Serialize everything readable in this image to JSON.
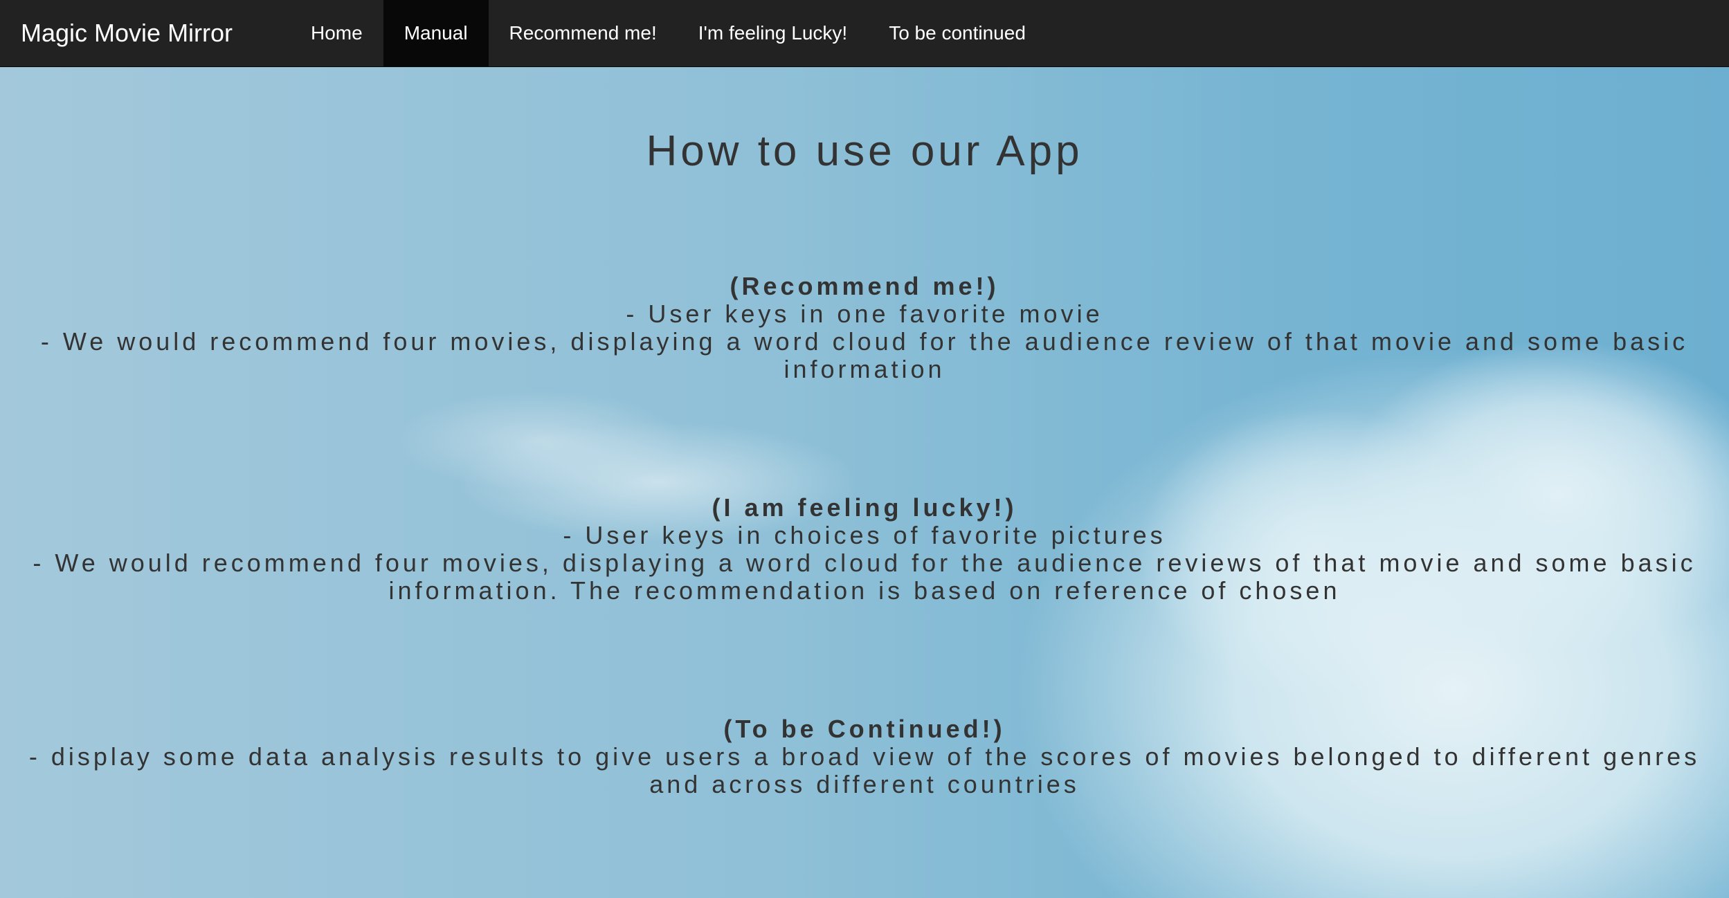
{
  "navbar": {
    "brand": "Magic Movie Mirror",
    "items": [
      {
        "label": "Home",
        "active": false
      },
      {
        "label": "Manual",
        "active": true
      },
      {
        "label": "Recommend me!",
        "active": false
      },
      {
        "label": "I'm feeling Lucky!",
        "active": false
      },
      {
        "label": "To be continued",
        "active": false
      }
    ]
  },
  "main": {
    "title": "How to use our App",
    "sections": [
      {
        "title": "(Recommend me!)",
        "lines": [
          "- User keys in one favorite movie",
          "- We would recommend four movies, displaying a word cloud for the audience review of that movie and some basic information"
        ]
      },
      {
        "title": "(I am feeling lucky!)",
        "lines": [
          "- User keys in choices of favorite pictures",
          "- We would recommend four movies, displaying a word cloud for the audience reviews of that movie and some basic information. The recommendation is based on reference of chosen"
        ]
      },
      {
        "title": "(To be Continued!)",
        "lines": [
          "- display some data analysis results to give users a broad view of the scores of movies belonged to different genres and across different countries"
        ]
      }
    ]
  },
  "colors": {
    "navbar_bg": "#222222",
    "nav_active_bg": "#080808",
    "text": "#333333",
    "sky": "#8fc0d8"
  }
}
